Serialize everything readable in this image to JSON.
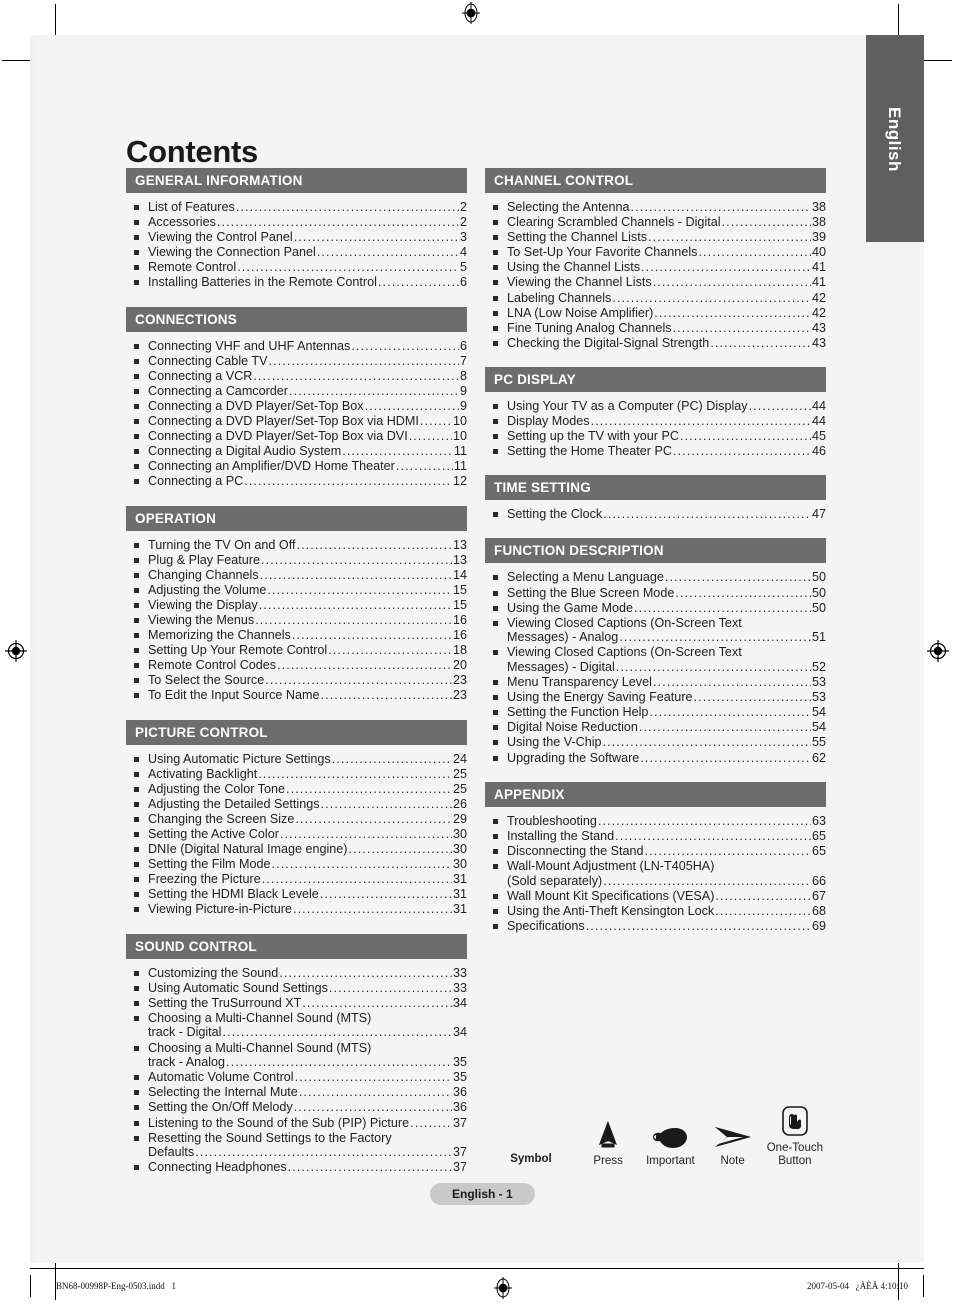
{
  "page": {
    "title": "Contents",
    "language_tab": "English",
    "page_number_label": "English - 1"
  },
  "columns": {
    "left": [
      {
        "header": "GENERAL INFORMATION",
        "entries": [
          {
            "lines": [
              "List of Features"
            ],
            "page": "2"
          },
          {
            "lines": [
              "Accessories"
            ],
            "page": "2"
          },
          {
            "lines": [
              "Viewing the Control Panel"
            ],
            "page": "3"
          },
          {
            "lines": [
              "Viewing the Connection Panel"
            ],
            "page": "4"
          },
          {
            "lines": [
              "Remote Control"
            ],
            "page": "5"
          },
          {
            "lines": [
              "Installing Batteries in the Remote Control"
            ],
            "page": "6"
          }
        ]
      },
      {
        "header": "CONNECTIONS",
        "entries": [
          {
            "lines": [
              "Connecting VHF and UHF Antennas"
            ],
            "page": "6"
          },
          {
            "lines": [
              "Connecting Cable TV"
            ],
            "page": "7"
          },
          {
            "lines": [
              "Connecting a VCR"
            ],
            "page": "8"
          },
          {
            "lines": [
              "Connecting a Camcorder"
            ],
            "page": "9"
          },
          {
            "lines": [
              "Connecting a DVD Player/Set-Top Box"
            ],
            "page": "9"
          },
          {
            "lines": [
              "Connecting a DVD Player/Set-Top Box via HDMI"
            ],
            "page": "10"
          },
          {
            "lines": [
              "Connecting a DVD Player/Set-Top Box via DVI"
            ],
            "page": "10"
          },
          {
            "lines": [
              "Connecting a Digital Audio System"
            ],
            "page": "11"
          },
          {
            "lines": [
              "Connecting an Amplifier/DVD Home Theater"
            ],
            "page": "11"
          },
          {
            "lines": [
              "Connecting a PC"
            ],
            "page": "12"
          }
        ]
      },
      {
        "header": "OPERATION",
        "entries": [
          {
            "lines": [
              "Turning the TV On and Off"
            ],
            "page": "13"
          },
          {
            "lines": [
              "Plug & Play Feature"
            ],
            "page": "13"
          },
          {
            "lines": [
              "Changing Channels"
            ],
            "page": "14"
          },
          {
            "lines": [
              "Adjusting the Volume"
            ],
            "page": "15"
          },
          {
            "lines": [
              "Viewing the Display"
            ],
            "page": "15"
          },
          {
            "lines": [
              "Viewing the Menus"
            ],
            "page": "16"
          },
          {
            "lines": [
              "Memorizing the Channels"
            ],
            "page": "16"
          },
          {
            "lines": [
              "Setting Up Your Remote Control"
            ],
            "page": "18"
          },
          {
            "lines": [
              "Remote Control Codes"
            ],
            "page": "20"
          },
          {
            "lines": [
              "To Select the Source"
            ],
            "page": "23"
          },
          {
            "lines": [
              "To Edit the Input Source Name"
            ],
            "page": "23"
          }
        ]
      },
      {
        "header": "PICTURE CONTROL",
        "entries": [
          {
            "lines": [
              "Using Automatic Picture Settings"
            ],
            "page": "24"
          },
          {
            "lines": [
              "Activating Backlight"
            ],
            "page": "25"
          },
          {
            "lines": [
              "Adjusting the Color Tone"
            ],
            "page": "25"
          },
          {
            "lines": [
              "Adjusting the Detailed Settings"
            ],
            "page": "26"
          },
          {
            "lines": [
              "Changing the Screen Size"
            ],
            "page": "29"
          },
          {
            "lines": [
              "Setting the Active Color"
            ],
            "page": "30"
          },
          {
            "lines": [
              "DNIe (Digital Natural Image engine)"
            ],
            "page": "30"
          },
          {
            "lines": [
              "Setting the Film Mode"
            ],
            "page": "30"
          },
          {
            "lines": [
              "Freezing the Picture"
            ],
            "page": "31"
          },
          {
            "lines": [
              "Setting the HDMI Black Levele"
            ],
            "page": "31"
          },
          {
            "lines": [
              "Viewing Picture-in-Picture"
            ],
            "page": "31"
          }
        ]
      },
      {
        "header": "SOUND CONTROL",
        "entries": [
          {
            "lines": [
              "Customizing the Sound"
            ],
            "page": "33"
          },
          {
            "lines": [
              "Using Automatic Sound Settings"
            ],
            "page": "33"
          },
          {
            "lines": [
              "Setting the TruSurround XT"
            ],
            "page": "34"
          },
          {
            "lines": [
              "Choosing a Multi-Channel Sound (MTS)",
              "track - Digital"
            ],
            "page": "34"
          },
          {
            "lines": [
              "Choosing a Multi-Channel Sound (MTS)",
              "track - Analog"
            ],
            "page": "35"
          },
          {
            "lines": [
              "Automatic Volume Control"
            ],
            "page": "35"
          },
          {
            "lines": [
              "Selecting the Internal Mute"
            ],
            "page": "36"
          },
          {
            "lines": [
              "Setting the On/Off Melody"
            ],
            "page": "36"
          },
          {
            "lines": [
              "Listening to the Sound of the Sub (PIP) Picture"
            ],
            "page": "37"
          },
          {
            "lines": [
              "Resetting the Sound Settings to the Factory",
              "Defaults"
            ],
            "page": "37"
          },
          {
            "lines": [
              "Connecting Headphones"
            ],
            "page": "37"
          }
        ]
      }
    ],
    "right": [
      {
        "header": "CHANNEL CONTROL",
        "entries": [
          {
            "lines": [
              "Selecting the Antenna"
            ],
            "page": "38"
          },
          {
            "lines": [
              "Clearing Scrambled Channels - Digital"
            ],
            "page": "38"
          },
          {
            "lines": [
              "Setting the Channel Lists"
            ],
            "page": "39"
          },
          {
            "lines": [
              "To Set-Up Your Favorite Channels"
            ],
            "page": "40"
          },
          {
            "lines": [
              "Using the Channel Lists"
            ],
            "page": "41"
          },
          {
            "lines": [
              "Viewing the Channel Lists"
            ],
            "page": "41"
          },
          {
            "lines": [
              "Labeling Channels"
            ],
            "page": "42"
          },
          {
            "lines": [
              "LNA (Low Noise Amplifier)"
            ],
            "page": "42"
          },
          {
            "lines": [
              "Fine Tuning Analog Channels"
            ],
            "page": "43"
          },
          {
            "lines": [
              "Checking the Digital-Signal Strength"
            ],
            "page": "43"
          }
        ]
      },
      {
        "header": "PC DISPLAY",
        "entries": [
          {
            "lines": [
              "Using Your TV as a Computer (PC) Display"
            ],
            "page": "44"
          },
          {
            "lines": [
              "Display Modes"
            ],
            "page": "44"
          },
          {
            "lines": [
              "Setting up the TV with your PC"
            ],
            "page": "45"
          },
          {
            "lines": [
              "Setting the Home Theater PC"
            ],
            "page": "46"
          }
        ]
      },
      {
        "header": "TIME SETTING",
        "entries": [
          {
            "lines": [
              "Setting the Clock"
            ],
            "page": "47"
          }
        ]
      },
      {
        "header": "FUNCTION DESCRIPTION",
        "entries": [
          {
            "lines": [
              "Selecting a Menu Language"
            ],
            "page": "50"
          },
          {
            "lines": [
              "Setting the Blue Screen Mode"
            ],
            "page": "50"
          },
          {
            "lines": [
              "Using the Game Mode"
            ],
            "page": "50"
          },
          {
            "lines": [
              "Viewing Closed Captions (On-Screen Text",
              "Messages) - Analog"
            ],
            "page": "51"
          },
          {
            "lines": [
              "Viewing Closed Captions (On-Screen Text",
              "Messages) - Digital"
            ],
            "page": "52"
          },
          {
            "lines": [
              "Menu Transparency Level"
            ],
            "page": "53"
          },
          {
            "lines": [
              "Using the Energy Saving Feature"
            ],
            "page": "53"
          },
          {
            "lines": [
              "Setting the Function Help"
            ],
            "page": "54"
          },
          {
            "lines": [
              "Digital Noise Reduction"
            ],
            "page": "54"
          },
          {
            "lines": [
              "Using the V-Chip"
            ],
            "page": "55"
          },
          {
            "lines": [
              "Upgrading the Software"
            ],
            "page": "62"
          }
        ]
      },
      {
        "header": "APPENDIX",
        "entries": [
          {
            "lines": [
              "Troubleshooting"
            ],
            "page": "63"
          },
          {
            "lines": [
              "Installing the Stand"
            ],
            "page": "65"
          },
          {
            "lines": [
              "Disconnecting the Stand"
            ],
            "page": "65"
          },
          {
            "lines": [
              "Wall-Mount Adjustment (LN-T405HA)",
              "(Sold separately)"
            ],
            "page": "66"
          },
          {
            "lines": [
              "Wall Mount Kit Specifications (VESA)"
            ],
            "page": "67"
          },
          {
            "lines": [
              "Using the Anti-Theft Kensington Lock"
            ],
            "page": "68"
          },
          {
            "lines": [
              "Specifications"
            ],
            "page": "69"
          }
        ]
      }
    ]
  },
  "symbol_legend": {
    "title": "Symbol",
    "items": [
      {
        "icon": "press-triangle-icon",
        "label": "Press"
      },
      {
        "icon": "pointing-hand-icon",
        "label": "Important"
      },
      {
        "icon": "note-arrow-icon",
        "label": "Note"
      },
      {
        "icon": "one-touch-button-icon",
        "label": "One-Touch\nButton"
      }
    ]
  },
  "production_footer": {
    "filename": "BN68-00998P-Eng-0503.indd   1",
    "timestamp": "2007-05-04   ¿ÀÈÄ 4:10:10"
  },
  "colors": {
    "section_header_bg": "#6d6d6d",
    "language_tab_bg": "#605f5f",
    "page_bg": "#f4f4f4",
    "pill_bg": "#c9c9c9",
    "text": "#1f1f1f"
  }
}
